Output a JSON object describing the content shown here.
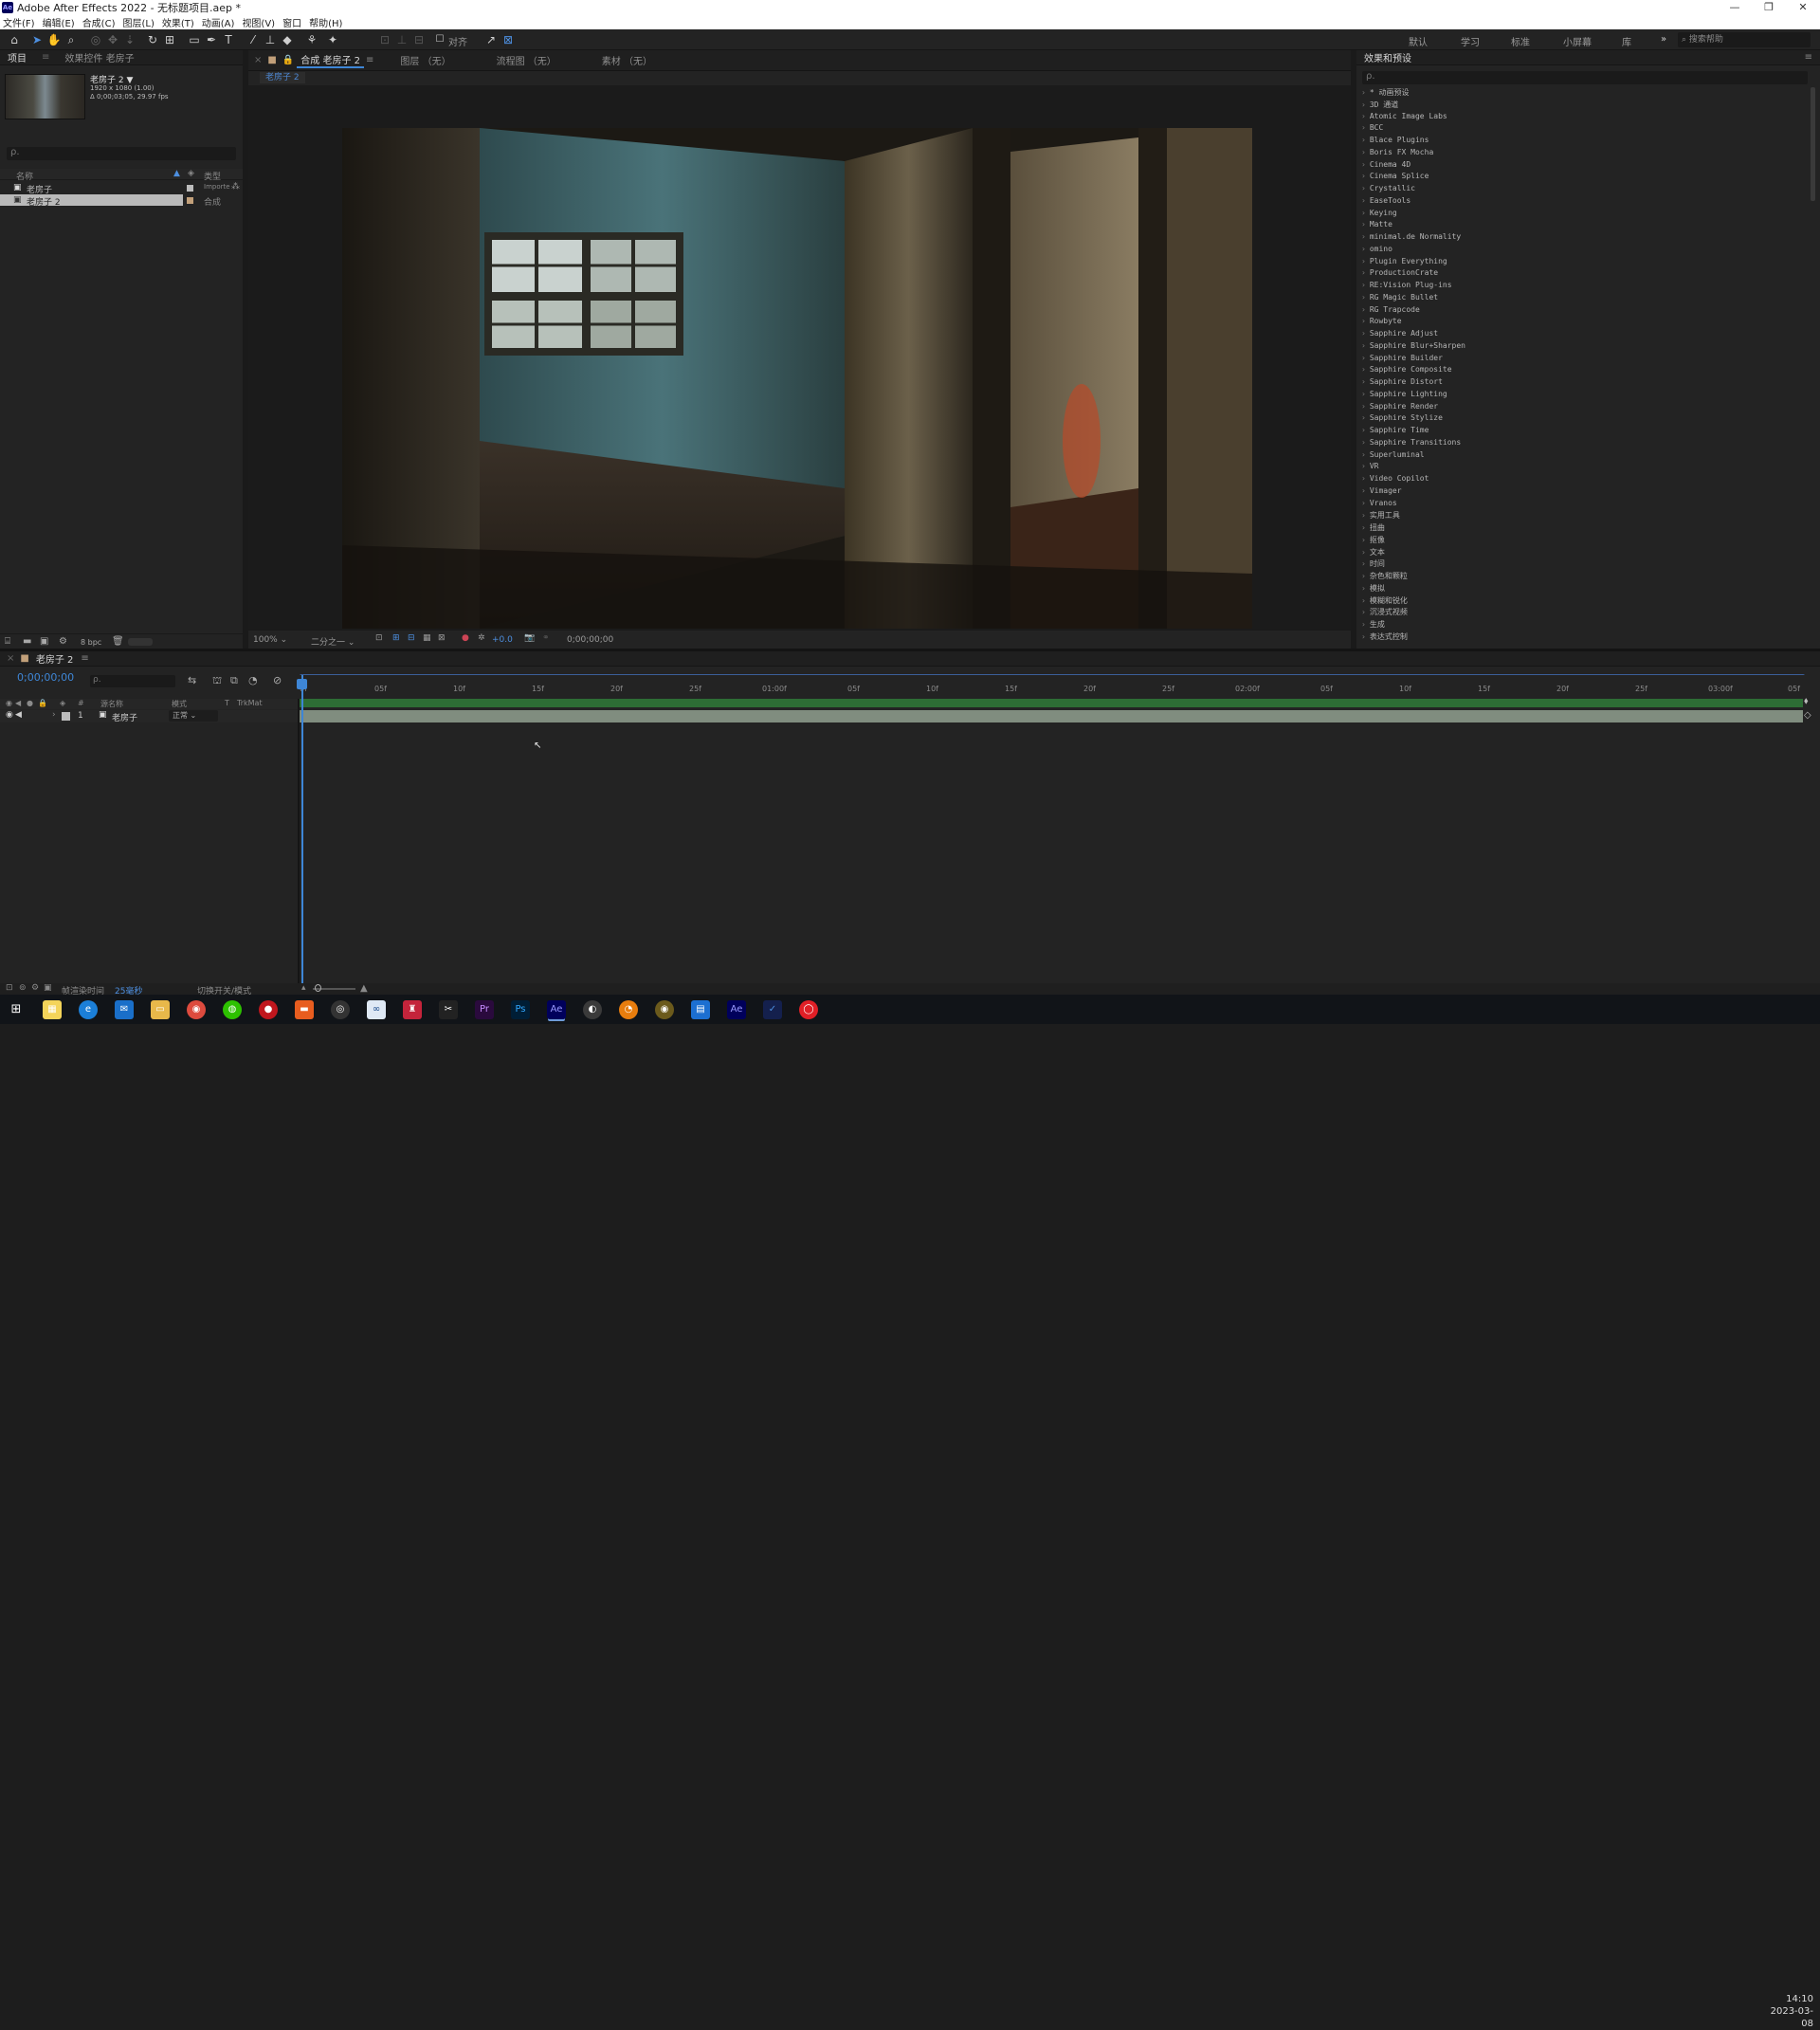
{
  "title_bar": {
    "app_icon": "Ae",
    "title": "Adobe After Effects 2022 - 无标题项目.aep *",
    "minimize": "—",
    "maximize": "❐",
    "close": "✕"
  },
  "menu": [
    "文件(F)",
    "编辑(E)",
    "合成(C)",
    "图层(L)",
    "效果(T)",
    "动画(A)",
    "视图(V)",
    "窗口",
    "帮助(H)"
  ],
  "toolbar": {
    "snap_label": "对齐",
    "workspaces": [
      "默认",
      "学习",
      "标准",
      "小屏幕",
      "库"
    ],
    "more": "»",
    "help_search_placeholder": "搜索帮助"
  },
  "project_panel": {
    "tabs": [
      "项目",
      "效果控件 老房子"
    ],
    "item_name": "老房子 2 ▼",
    "item_info1": "1920 x 1080 (1.00)",
    "item_info2": "Δ 0;00;03;05, 29.97 fps",
    "search_placeholder": "ρ.",
    "col_name": "名称",
    "col_type": "类型",
    "rows": [
      {
        "name": "老房子",
        "type": "Importe",
        "selected": false,
        "color": "#bdbdbd"
      },
      {
        "name": "老房子 2",
        "type": "合成",
        "selected": true,
        "color": "#c2a07a"
      }
    ],
    "bpc": "8 bpc"
  },
  "comp_panel": {
    "tabs": [
      "合成 老房子 2",
      "图层 （无）",
      "流程图 （无）",
      "素材 （无）"
    ],
    "subtab": "老房子 2",
    "zoom": "100%",
    "resolution": "二分之一",
    "exposure": "+0.0",
    "timecode": "0;00;00;00"
  },
  "effects_panel": {
    "title": "效果和预设",
    "search_placeholder": "ρ.",
    "items": [
      "* 动画预设",
      "3D 通道",
      "Atomic Image Labs",
      "BCC",
      "Blace Plugins",
      "Boris FX Mocha",
      "Cinema 4D",
      "Cinema Splice",
      "Crystallic",
      "EaseTools",
      "Keying",
      "Matte",
      "minimal.de Normality",
      "omino",
      "Plugin Everything",
      "ProductionCrate",
      "RE:Vision Plug-ins",
      "RG Magic Bullet",
      "RG Trapcode",
      "Rowbyte",
      "Sapphire Adjust",
      "Sapphire Blur+Sharpen",
      "Sapphire Builder",
      "Sapphire Composite",
      "Sapphire Distort",
      "Sapphire Lighting",
      "Sapphire Render",
      "Sapphire Stylize",
      "Sapphire Time",
      "Sapphire Transitions",
      "Superluminal",
      "VR",
      "Video Copilot",
      "Vimager",
      "Vranos",
      "实用工具",
      "扭曲",
      "抠像",
      "文本",
      "时间",
      "杂色和颗粒",
      "模拟",
      "模糊和锐化",
      "沉浸式视频",
      "生成",
      "表达式控制"
    ]
  },
  "timeline": {
    "tab": "老房子 2",
    "timecode": "0;00;00;00",
    "search_placeholder": "ρ.",
    "ticks": [
      "0f",
      "05f",
      "10f",
      "15f",
      "20f",
      "25f",
      "01:00f",
      "05f",
      "10f",
      "15f",
      "20f",
      "25f",
      "02:00f",
      "05f",
      "10f",
      "15f",
      "20f",
      "25f",
      "03:00f",
      "05f"
    ],
    "col_source": "源名称",
    "col_mode": "模式",
    "col_t": "T",
    "col_trkmat": "TrkMat",
    "layer": {
      "index": "1",
      "name": "老房子",
      "mode": "正常"
    },
    "footer_render_label": "帧渲染时间",
    "footer_render_value": "25毫秒",
    "footer_toggle": "切换开关/模式"
  },
  "taskbar": {
    "time": "14:10",
    "date": "2023-03-08"
  }
}
